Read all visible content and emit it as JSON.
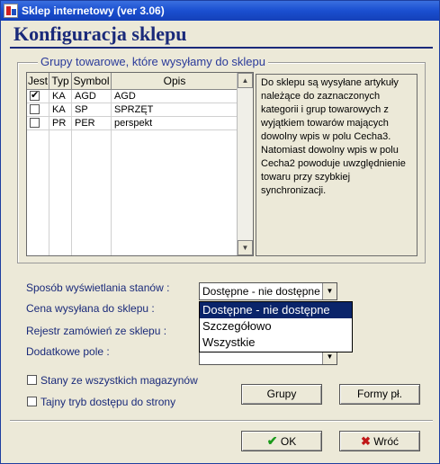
{
  "window": {
    "title": "Sklep internetowy (ver 3.06)"
  },
  "heading": "Konfiguracja sklepu",
  "group": {
    "legend": "Grupy towarowe, które wysyłamy do sklepu",
    "columns": [
      "Jest",
      "Typ",
      "Symbol",
      "Opis"
    ],
    "rows": [
      {
        "checked": true,
        "checked_glyph": "✔",
        "typ": "KA",
        "symbol": "AGD",
        "opis": "AGD"
      },
      {
        "checked": false,
        "checked_glyph": "",
        "typ": "KA",
        "symbol": "SP",
        "opis": "SPRZĘT"
      },
      {
        "checked": false,
        "checked_glyph": "",
        "typ": "PR",
        "symbol": "PER",
        "opis": "perspekt"
      }
    ],
    "info": "Do sklepu są wysyłane artykuły należące do zaznaczonych kategorii i grup towarowych z wyjątkiem towarów mających dowolny wpis w polu Cecha3. Natomiast dowolny wpis w polu Cecha2 powoduje uwzględnienie towaru przy szybkiej synchronizacji."
  },
  "form": {
    "stock_display_label": "Sposób wyświetlania stanów :",
    "stock_display_value": "Dostępne - nie dostępne",
    "price_label": "Cena wysyłana do sklepu :",
    "orders_label": "Rejestr zamówień ze sklepu :",
    "extra_field_label": "Dodatkowe pole  :",
    "dropdown_options": [
      "Dostępne - nie dostępne",
      "Szczegółowo",
      "Wszystkie"
    ]
  },
  "checkboxes": {
    "all_warehouses": "Stany ze wszystkich magazynów",
    "secret_mode": "Tajny tryb dostępu do strony"
  },
  "buttons": {
    "groups": "Grupy",
    "forms": "Formy pł.",
    "ok": "OK",
    "back": "Wróć"
  },
  "icons": {
    "ok": "✔",
    "back": "✖",
    "scroll_up": "▲",
    "scroll_down": "▼",
    "combo_arrow": "▼"
  }
}
